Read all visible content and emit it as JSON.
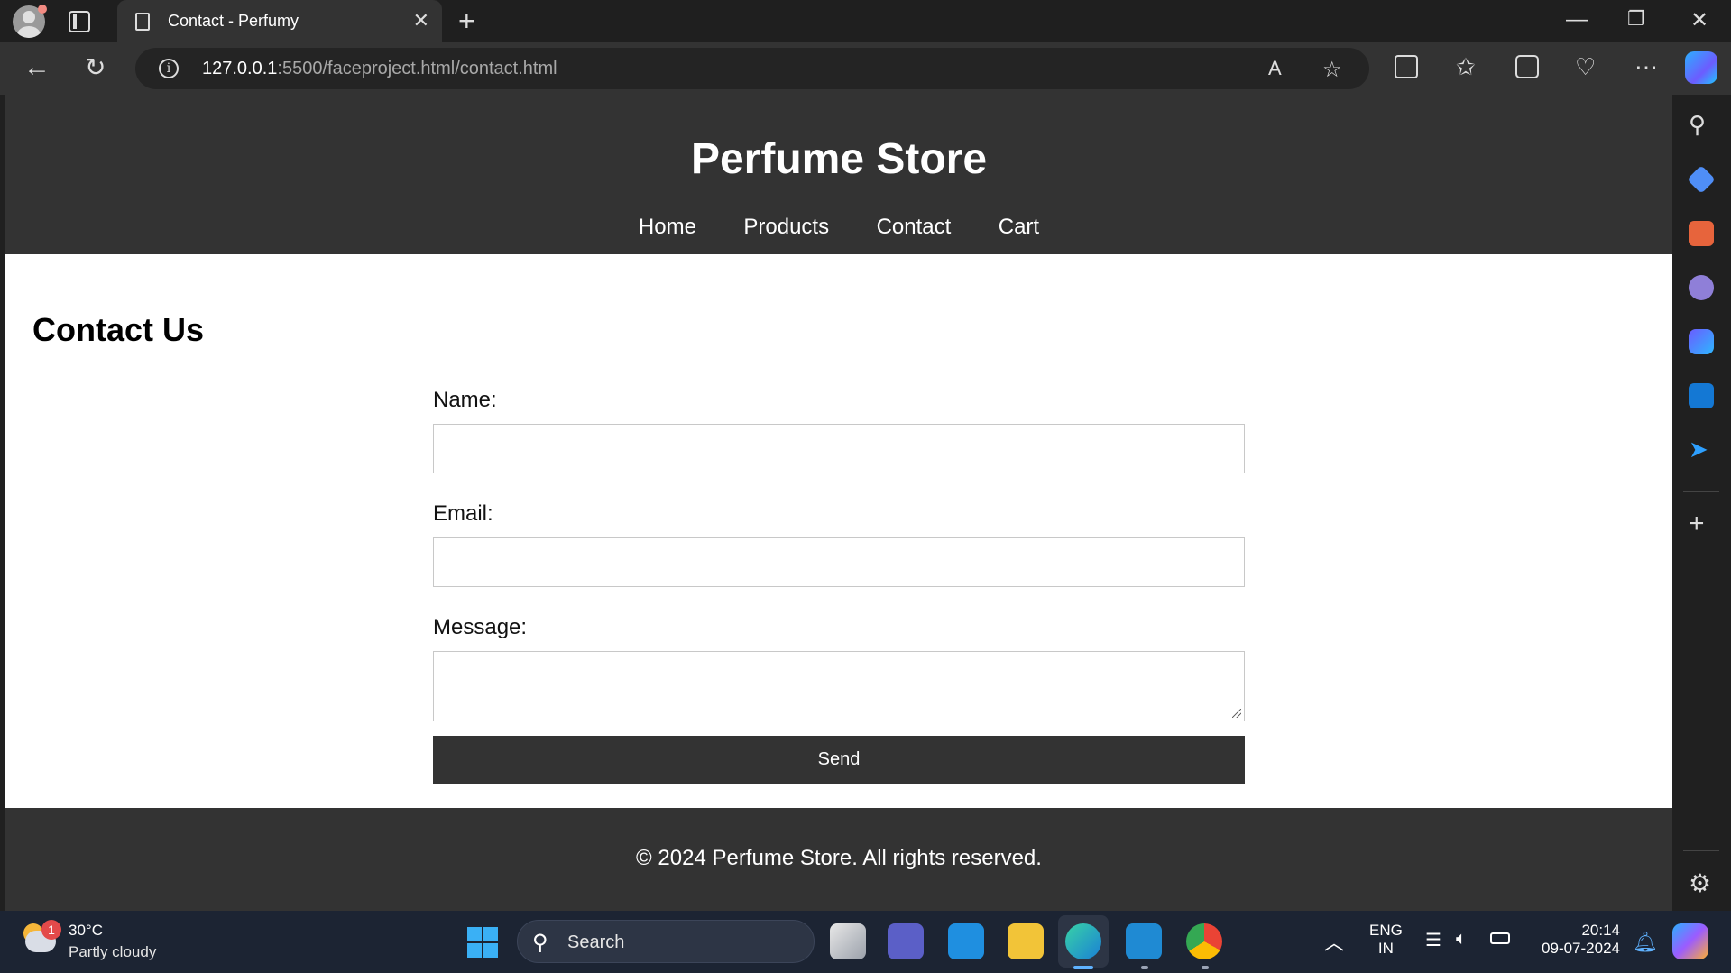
{
  "browser": {
    "tab_title": "Contact - Perfumy",
    "tab_close": "✕",
    "new_tab": "+",
    "url_host": "127.0.0.1",
    "url_path": ":5500/faceproject.html/contact.html",
    "read_aloud": "A",
    "window_minimize": "—",
    "window_restore": "❐",
    "window_close": "✕"
  },
  "site": {
    "title": "Perfume Store",
    "nav": [
      "Home",
      "Products",
      "Contact",
      "Cart"
    ]
  },
  "page": {
    "heading": "Contact Us",
    "form": {
      "name_label": "Name:",
      "name_value": "",
      "email_label": "Email:",
      "email_value": "",
      "message_label": "Message:",
      "message_value": "",
      "submit_label": "Send"
    },
    "footer": "© 2024 Perfume Store. All rights reserved."
  },
  "taskbar": {
    "weather_temp": "30°C",
    "weather_cond": "Partly cloudy",
    "weather_badge": "1",
    "search_placeholder": "Search",
    "apps": [
      "task-view",
      "teams",
      "mail",
      "file-explorer",
      "edge",
      "vs-code",
      "chrome"
    ],
    "lang_top": "ENG",
    "lang_bottom": "IN",
    "time": "20:14",
    "date": "09-07-2024"
  },
  "colors": {
    "header_bg": "#333333",
    "page_bg": "#ffffff",
    "taskbar_bg": "#1c2433",
    "accent": "#5fb2ff"
  }
}
